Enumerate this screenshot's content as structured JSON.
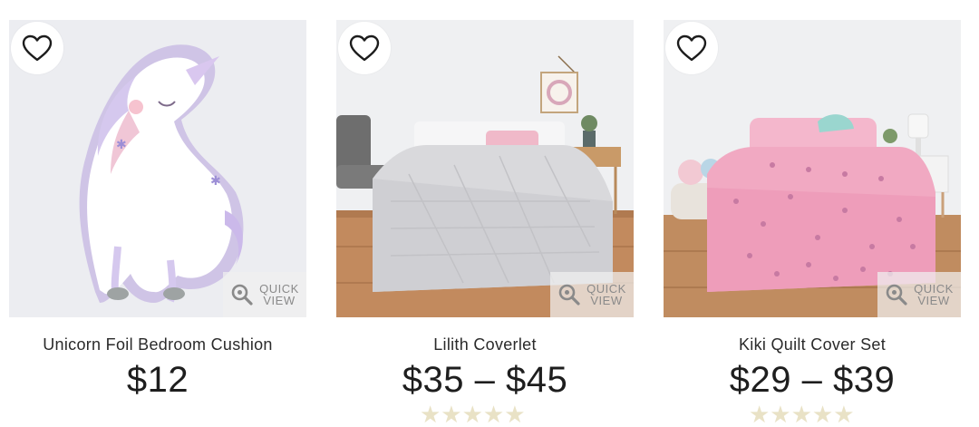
{
  "products": [
    {
      "name": "Unicorn Foil Bedroom Cushion",
      "price": "$12",
      "image_icon": "unicorn-cushion-image",
      "wishlist_icon": "heart-outline-icon",
      "quick_view_label": "QUICK\nVIEW"
    },
    {
      "name": "Lilith Coverlet",
      "price": "$35 – $45",
      "image_icon": "grey-coverlet-bed-image",
      "wishlist_icon": "heart-outline-icon",
      "quick_view_label": "QUICK\nVIEW",
      "rating_stars": "★★★★★"
    },
    {
      "name": "Kiki Quilt Cover Set",
      "price": "$29 – $39",
      "image_icon": "pink-quilt-bed-image",
      "wishlist_icon": "heart-outline-icon",
      "quick_view_label": "QUICK\nVIEW",
      "rating_stars": "★★★★★"
    }
  ],
  "colors": {
    "text_primary": "#222222",
    "quick_view_text": "#8a8a8a",
    "star_partial": "#e9e2c6"
  }
}
